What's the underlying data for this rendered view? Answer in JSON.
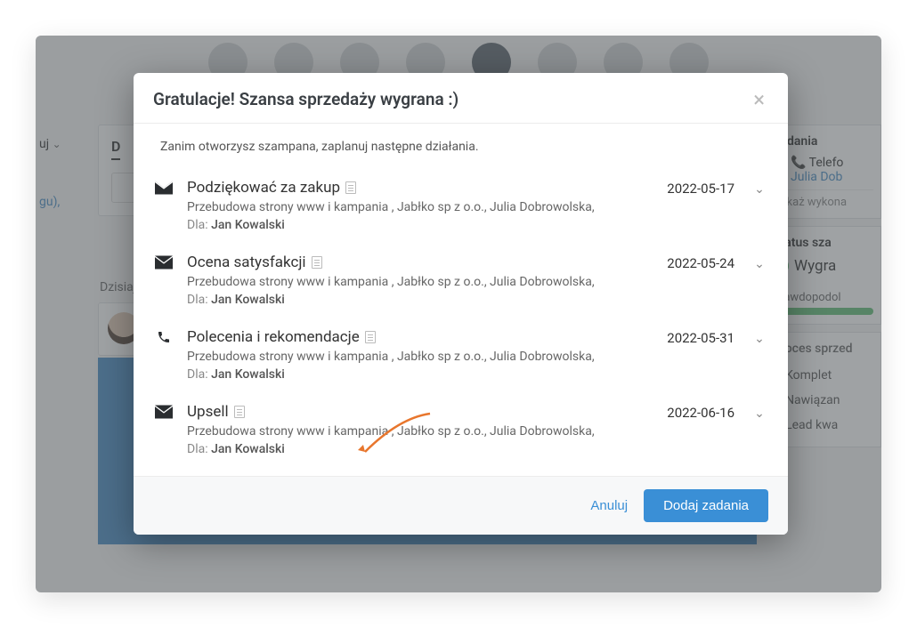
{
  "bg": {
    "left": {
      "row1": "uj",
      "row2": "gu),"
    },
    "main_header": "D",
    "dzisiaj": "Dzisiaj",
    "right": {
      "zadania_title": "Zadania",
      "phone_label": "Telefo",
      "phone_person": "Julia Dob",
      "pokaz": "Pokaż wykona",
      "status_title": "Status sza",
      "status_value": "Wygra",
      "prob_label": "Prawdopodol",
      "proces_title": "Proces sprzed",
      "steps": [
        "Komplet",
        "Nawiązan",
        "Lead kwa"
      ]
    }
  },
  "modal": {
    "title": "Gratulacje! Szansa sprzedaży wygrana :)",
    "intro": "Zanim otworzysz szampana, zaplanuj następne działania.",
    "for_label": "Dla:",
    "cancel": "Anuluj",
    "submit": "Dodaj zadania",
    "tasks": [
      {
        "icon": "mail",
        "title": "Podziękować za zakup",
        "sub": "Przebudowa strony www i kampania , Jabłko sp z o.o., Julia Dobrowolska,",
        "for": "Jan Kowalski",
        "date": "2022-05-17"
      },
      {
        "icon": "mail",
        "title": "Ocena satysfakcji",
        "sub": "Przebudowa strony www i kampania , Jabłko sp z o.o., Julia Dobrowolska,",
        "for": "Jan Kowalski",
        "date": "2022-05-24"
      },
      {
        "icon": "phone",
        "title": "Polecenia i rekomendacje",
        "sub": "Przebudowa strony www i kampania , Jabłko sp z o.o., Julia Dobrowolska,",
        "for": "Jan Kowalski",
        "date": "2022-05-31"
      },
      {
        "icon": "mail",
        "title": "Upsell",
        "sub": "Przebudowa strony www i kampania , Jabłko sp z o.o., Julia Dobrowolska,",
        "for": "Jan Kowalski",
        "date": "2022-06-16"
      }
    ]
  }
}
